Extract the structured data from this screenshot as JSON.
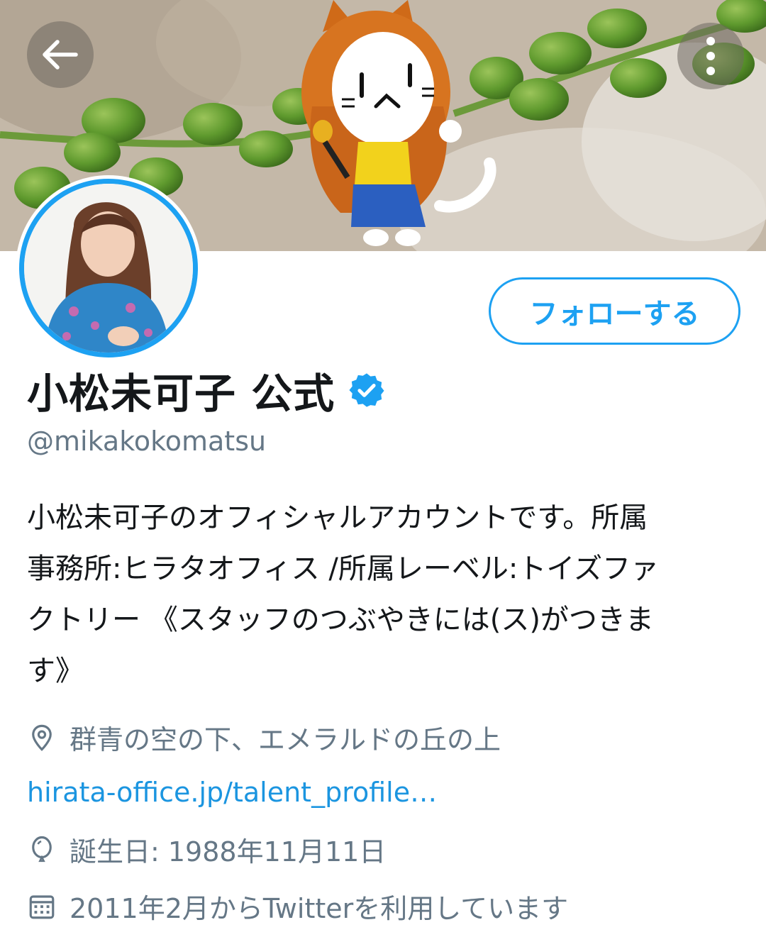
{
  "header": {
    "back_icon": "arrow-left-icon",
    "more_icon": "vertical-dots-icon"
  },
  "profile": {
    "display_name": "小松未可子 公式",
    "verified": true,
    "handle": "@mikakokomatsu",
    "follow_label": "フォローする",
    "bio_lines": [
      "小松未可子のオフィシャルアカウントです。所属",
      "事務所:ヒラタオフィス /所属レーベル:トイズファ",
      "クトリー 《スタッフのつぶやきには(ス)がつきま",
      "す》"
    ],
    "location": "群青の空の下、エメラルドの丘の上",
    "website": "hirata-office.jp/talent_profile…",
    "birthday": "誕生日: 1988年11月11日",
    "joined": "2011年2月からTwitterを利用しています"
  },
  "colors": {
    "accent": "#1da1f2",
    "link": "#1b95e0",
    "text": "#14171a",
    "secondary": "#657786"
  }
}
